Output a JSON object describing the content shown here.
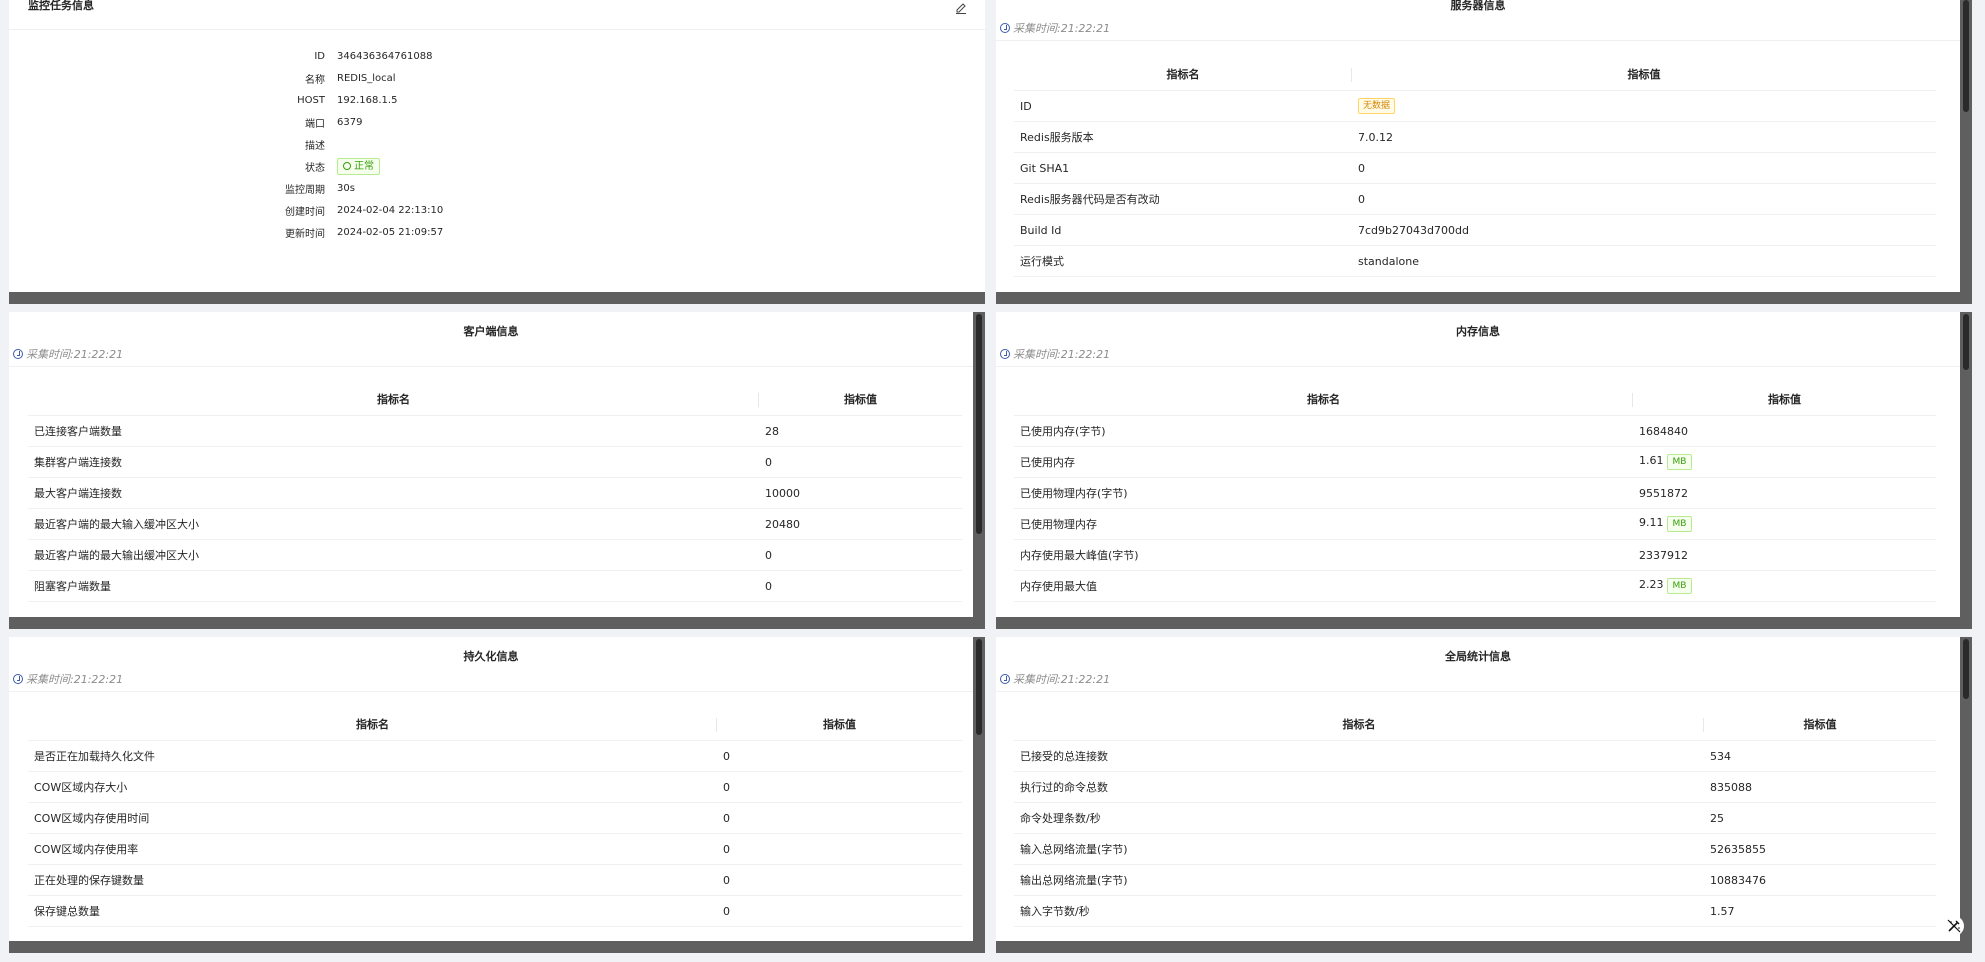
{
  "task_info": {
    "title": "监控任务信息",
    "rows": [
      {
        "label": "ID",
        "value": "346436364761088"
      },
      {
        "label": "名称",
        "value": "REDIS_local"
      },
      {
        "label": "HOST",
        "value": "192.168.1.5"
      },
      {
        "label": "端口",
        "value": "6379"
      },
      {
        "label": "描述",
        "value": ""
      },
      {
        "label": "状态",
        "value": "正常"
      },
      {
        "label": "监控周期",
        "value": "30s"
      },
      {
        "label": "创建时间",
        "value": "2024-02-04 22:13:10"
      },
      {
        "label": "更新时间",
        "value": "2024-02-05 21:09:57"
      }
    ]
  },
  "common": {
    "collect_time": "采集时间:21:22:21",
    "col_name": "指标名",
    "col_value": "指标值",
    "no_data": "无数据",
    "unit_mb": "MB"
  },
  "server_info": {
    "title": "服务器信息",
    "rows": [
      {
        "name": "ID",
        "value": ""
      },
      {
        "name": "Redis服务版本",
        "value": "7.0.12"
      },
      {
        "name": "Git SHA1",
        "value": "0"
      },
      {
        "name": "Redis服务器代码是否有改动",
        "value": "0"
      },
      {
        "name": "Build Id",
        "value": "7cd9b27043d700dd"
      },
      {
        "name": "运行模式",
        "value": "standalone"
      }
    ]
  },
  "client_info": {
    "title": "客户端信息",
    "rows": [
      {
        "name": "已连接客户端数量",
        "value": "28"
      },
      {
        "name": "集群客户端连接数",
        "value": "0"
      },
      {
        "name": "最大客户端连接数",
        "value": "10000"
      },
      {
        "name": "最近客户端的最大输入缓冲区大小",
        "value": "20480"
      },
      {
        "name": "最近客户端的最大输出缓冲区大小",
        "value": "0"
      },
      {
        "name": "阻塞客户端数量",
        "value": "0"
      }
    ]
  },
  "memory_info": {
    "title": "内存信息",
    "rows": [
      {
        "name": "已使用内存(字节)",
        "value": "1684840"
      },
      {
        "name": "已使用内存",
        "value": "1.61"
      },
      {
        "name": "已使用物理内存(字节)",
        "value": "9551872"
      },
      {
        "name": "已使用物理内存",
        "value": "9.11"
      },
      {
        "name": "内存使用最大峰值(字节)",
        "value": "2337912"
      },
      {
        "name": "内存使用最大值",
        "value": "2.23"
      }
    ]
  },
  "persistence_info": {
    "title": "持久化信息",
    "rows": [
      {
        "name": "是否正在加载持久化文件",
        "value": "0"
      },
      {
        "name": "COW区域内存大小",
        "value": "0"
      },
      {
        "name": "COW区域内存使用时间",
        "value": "0"
      },
      {
        "name": "COW区域内存使用率",
        "value": "0"
      },
      {
        "name": "正在处理的保存键数量",
        "value": "0"
      },
      {
        "name": "保存键总数量",
        "value": "0"
      }
    ]
  },
  "stats_info": {
    "title": "全局统计信息",
    "rows": [
      {
        "name": "已接受的总连接数",
        "value": "534"
      },
      {
        "name": "执行过的命令总数",
        "value": "835088"
      },
      {
        "name": "命令处理条数/秒",
        "value": "25"
      },
      {
        "name": "输入总网络流量(字节)",
        "value": "52635855"
      },
      {
        "name": "输出总网络流量(字节)",
        "value": "10883476"
      },
      {
        "name": "输入字节数/秒",
        "value": "1.57"
      }
    ]
  }
}
